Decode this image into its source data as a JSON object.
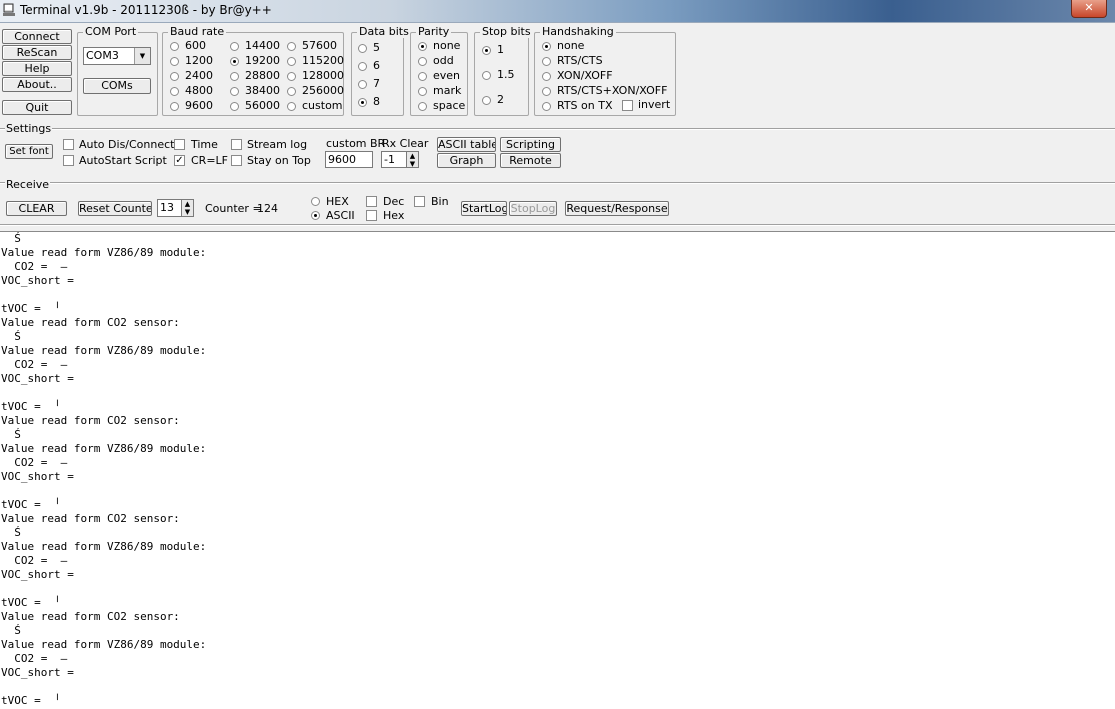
{
  "window": {
    "title": "Terminal v1.9b - 20111230ß - by Br@y++",
    "close_label": "✕"
  },
  "left_buttons": {
    "connect": "Connect",
    "rescan": "ReScan",
    "help": "Help",
    "about": "About..",
    "quit": "Quit"
  },
  "com_port": {
    "title": "COM Port",
    "selected": "COM3",
    "coms_button": "COMs"
  },
  "baud_rate": {
    "title": "Baud rate",
    "options": [
      "600",
      "1200",
      "2400",
      "4800",
      "9600",
      "14400",
      "19200",
      "28800",
      "38400",
      "56000",
      "57600",
      "115200",
      "128000",
      "256000",
      "custom"
    ],
    "selected": "19200"
  },
  "data_bits": {
    "title": "Data bits",
    "options": [
      "5",
      "6",
      "7",
      "8"
    ],
    "selected": "8"
  },
  "parity": {
    "title": "Parity",
    "options": [
      "none",
      "odd",
      "even",
      "mark",
      "space"
    ],
    "selected": "none"
  },
  "stop_bits": {
    "title": "Stop bits",
    "options": [
      "1",
      "1.5",
      "2"
    ],
    "selected": "1"
  },
  "handshaking": {
    "title": "Handshaking",
    "options": [
      "none",
      "RTS/CTS",
      "XON/XOFF",
      "RTS/CTS+XON/XOFF",
      "RTS on TX"
    ],
    "selected": "none",
    "invert_label": "invert"
  },
  "settings": {
    "title": "Settings",
    "set_font": "Set font",
    "auto_dis_connect": "Auto Dis/Connect",
    "autostart_script": "AutoStart Script",
    "time": "Time",
    "cr_lf": "CR=LF",
    "cr_lf_checked": true,
    "stream_log": "Stream log",
    "stay_on_top": "Stay on Top",
    "custom_br_label": "custom BR",
    "custom_br_value": "9600",
    "rx_clear_label": "Rx Clear",
    "rx_clear_value": "-1",
    "ascii_table": "ASCII table",
    "scripting": "Scripting",
    "graph": "Graph",
    "remote": "Remote"
  },
  "receive": {
    "title": "Receive",
    "clear": "CLEAR",
    "reset_counter": "Reset Counter",
    "counter_spin": "13",
    "counter_label": "Counter =",
    "counter_value": "124",
    "hex": "HEX",
    "ascii": "ASCII",
    "mode_selected": "ASCII",
    "dec": "Dec",
    "bin": "Bin",
    "hex_check": "Hex",
    "start_log": "StartLog",
    "stop_log": "StopLog",
    "request_response": "Request/Response"
  },
  "terminal_lines": [
    "  Ś",
    "Value read form VZ86/89 module:",
    "  CO2 =  –",
    "VOC_short =",
    "",
    "tVOC =  ╵",
    "Value read form CO2 sensor:",
    "  Ś",
    "Value read form VZ86/89 module:",
    "  CO2 =  –",
    "VOC_short =",
    "",
    "tVOC =  ╵",
    "Value read form CO2 sensor:",
    "  Ś",
    "Value read form VZ86/89 module:",
    "  CO2 =  –",
    "VOC_short =",
    "",
    "tVOC =  ╵",
    "Value read form CO2 sensor:",
    "  Ś",
    "Value read form VZ86/89 module:",
    "  CO2 =  –",
    "VOC_short =",
    "",
    "tVOC =  ╵",
    "Value read form CO2 sensor:",
    "  Ś",
    "Value read form VZ86/89 module:",
    "  CO2 =  –",
    "VOC_short =",
    "",
    "tVOC =  ╵"
  ]
}
